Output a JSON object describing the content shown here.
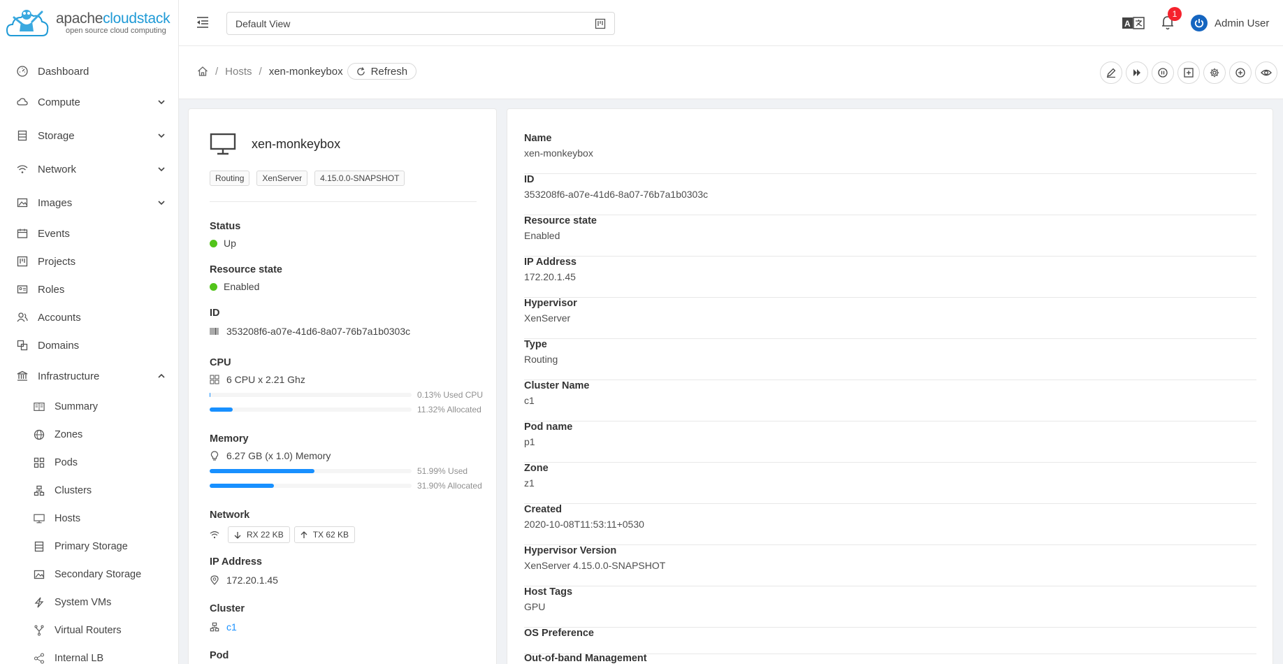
{
  "brand": {
    "name_prefix": "apache",
    "name_suffix": "cloudstack",
    "tagline": "open source cloud computing"
  },
  "sidebar": {
    "items": [
      {
        "label": "Dashboard",
        "icon": "dashboard-icon"
      },
      {
        "label": "Compute",
        "icon": "cloud-icon"
      },
      {
        "label": "Storage",
        "icon": "database-icon"
      },
      {
        "label": "Network",
        "icon": "wifi-icon"
      },
      {
        "label": "Images",
        "icon": "picture-icon"
      },
      {
        "label": "Events",
        "icon": "calendar-icon"
      },
      {
        "label": "Projects",
        "icon": "project-icon"
      },
      {
        "label": "Roles",
        "icon": "idcard-icon"
      },
      {
        "label": "Accounts",
        "icon": "team-icon"
      },
      {
        "label": "Domains",
        "icon": "block-icon"
      },
      {
        "label": "Infrastructure",
        "icon": "bank-icon"
      }
    ],
    "sub_items": [
      {
        "label": "Summary",
        "icon": "read-icon"
      },
      {
        "label": "Zones",
        "icon": "global-icon"
      },
      {
        "label": "Pods",
        "icon": "appstore-icon"
      },
      {
        "label": "Clusters",
        "icon": "cluster-icon"
      },
      {
        "label": "Hosts",
        "icon": "desktop-icon"
      },
      {
        "label": "Primary Storage",
        "icon": "database-icon"
      },
      {
        "label": "Secondary Storage",
        "icon": "picture-icon"
      },
      {
        "label": "System VMs",
        "icon": "thunderbolt-icon"
      },
      {
        "label": "Virtual Routers",
        "icon": "fork-icon"
      },
      {
        "label": "Internal LB",
        "icon": "share-icon"
      }
    ]
  },
  "header": {
    "view": "Default View",
    "notifications": "1",
    "user": "Admin User"
  },
  "breadcrumb": {
    "parent": "Hosts",
    "current": "xen-monkeybox",
    "refresh": "Refresh",
    "separator": "/"
  },
  "host": {
    "name": "xen-monkeybox",
    "tags": [
      "Routing",
      "XenServer",
      "4.15.0.0-SNAPSHOT"
    ],
    "status_label": "Status",
    "status": "Up",
    "resource_state_label": "Resource state",
    "resource_state": "Enabled",
    "id_label": "ID",
    "id": "353208f6-a07e-41d6-8a07-76b7a1b0303c",
    "cpu_label": "CPU",
    "cpu": "6 CPU x 2.21 Ghz",
    "cpu_used_text": "0.13% Used CPU",
    "cpu_used": 0.13,
    "cpu_alloc_text": "11.32% Allocated",
    "cpu_alloc": 11.32,
    "memory_label": "Memory",
    "memory": "6.27 GB (x 1.0) Memory",
    "mem_used_text": "51.99% Used",
    "mem_used": 51.99,
    "mem_alloc_text": "31.90% Allocated",
    "mem_alloc": 31.9,
    "network_label": "Network",
    "rx": "RX 22 KB",
    "tx": "TX 62 KB",
    "ip_label": "IP Address",
    "ip": "172.20.1.45",
    "cluster_label": "Cluster",
    "cluster": "c1",
    "pod_label": "Pod"
  },
  "details": [
    {
      "label": "Name",
      "value": "xen-monkeybox"
    },
    {
      "label": "ID",
      "value": "353208f6-a07e-41d6-8a07-76b7a1b0303c"
    },
    {
      "label": "Resource state",
      "value": "Enabled"
    },
    {
      "label": "IP Address",
      "value": "172.20.1.45"
    },
    {
      "label": "Hypervisor",
      "value": "XenServer"
    },
    {
      "label": "Type",
      "value": "Routing"
    },
    {
      "label": "Cluster Name",
      "value": "c1"
    },
    {
      "label": "Pod name",
      "value": "p1"
    },
    {
      "label": "Zone",
      "value": "z1"
    },
    {
      "label": "Created",
      "value": "2020-10-08T11:53:11+0530"
    },
    {
      "label": "Hypervisor Version",
      "value": "XenServer 4.15.0.0-SNAPSHOT"
    },
    {
      "label": "Host Tags",
      "value": "GPU"
    },
    {
      "label": "OS Preference",
      "value": ""
    },
    {
      "label": "Out-of-band Management",
      "value": ""
    }
  ],
  "colors": {
    "accent": "#1890ff",
    "status_ok": "#52c41a",
    "badge": "#f5222d"
  }
}
